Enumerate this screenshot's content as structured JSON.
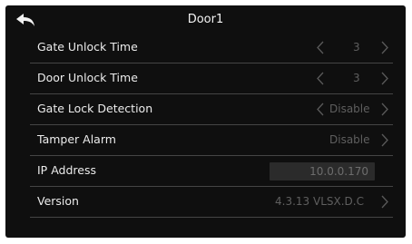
{
  "header": {
    "title": "Door1",
    "back_icon": "back-arrow-icon"
  },
  "settings": {
    "gate_unlock_time": {
      "label": "Gate Unlock Time",
      "value": "3"
    },
    "door_unlock_time": {
      "label": "Door Unlock Time",
      "value": "3"
    },
    "gate_lock_detection": {
      "label": "Gate Lock Detection",
      "value": "Disable"
    },
    "tamper_alarm": {
      "label": "Tamper Alarm",
      "value": "Disable"
    },
    "ip_address": {
      "label": "IP Address",
      "value": "10.0.0.170"
    },
    "version": {
      "label": "Version",
      "value": "4.3.13 VLSX.D.C"
    }
  },
  "colors": {
    "background": "#0f0f0f",
    "text": "#ececec",
    "muted_value": "#5f5f5f",
    "divider": "#454545",
    "ip_field": "#2b2b2b"
  }
}
